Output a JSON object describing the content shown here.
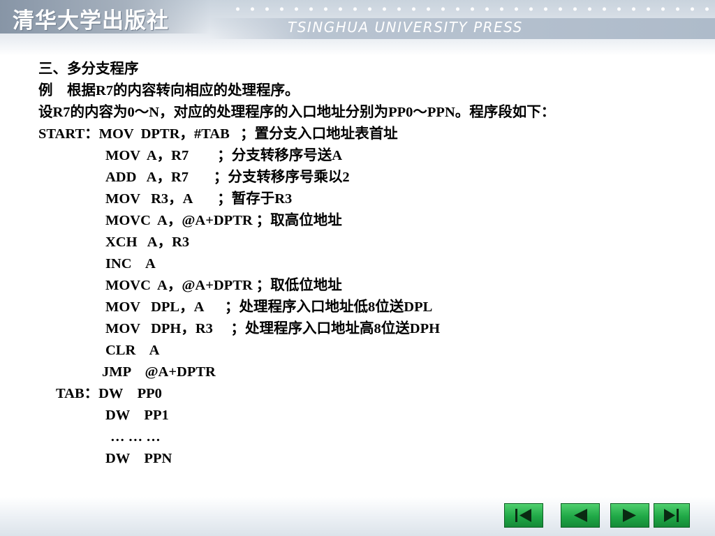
{
  "header": {
    "publisher_cn": "清华大学出版社",
    "publisher_en": "TSINGHUA UNIVERSITY PRESS"
  },
  "content": {
    "lines": [
      "三、多分支程序",
      "例　根据R7的内容转向相应的处理程序。",
      "设R7的内容为0～N，对应的处理程序的入口地址分别为PP0～PPN。程序段如下：",
      "START：MOV  DPTR，#TAB   ；置分支入口地址表首址",
      "MOV  A，R7        ；分支转移序号送A",
      "ADD   A，R7       ；分支转移序号乘以2",
      "MOV   R3，A       ；暂存于R3",
      "MOVC  A，@A+DPTR ；取高位地址",
      "XCH   A，R3",
      "INC    A",
      "MOVC  A，@A+DPTR ；取低位地址",
      "MOV   DPL，A      ；处理程序入口地址低8位送DPL",
      "MOV   DPH，R3     ；处理程序入口地址高8位送DPH",
      "CLR    A",
      "JMP    @A+DPTR",
      "TAB：DW    PP0",
      "DW    PP1",
      "… … …",
      "DW    PPN"
    ]
  },
  "nav": {
    "buttons": [
      {
        "name": "first-page-button",
        "icon": "first-page-icon"
      },
      {
        "name": "previous-page-button",
        "icon": "previous-page-icon"
      },
      {
        "name": "next-page-button",
        "icon": "next-page-icon"
      },
      {
        "name": "last-page-button",
        "icon": "last-page-icon"
      }
    ],
    "button_color": "#1fa846",
    "icon_color": "#0a2a12"
  }
}
